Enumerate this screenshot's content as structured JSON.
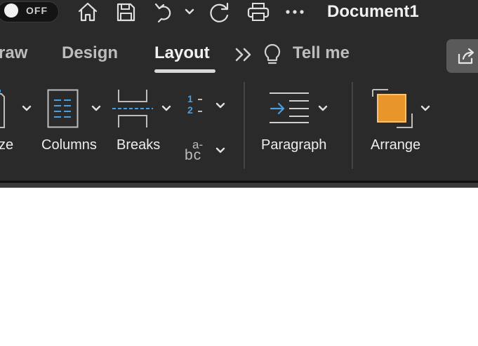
{
  "titlebar": {
    "autosave_label": "OFF",
    "document_title": "Document1",
    "icons": [
      "home-icon",
      "save-icon",
      "undo-icon",
      "chevron-down-icon",
      "redo-icon",
      "print-icon",
      "more-icon"
    ]
  },
  "tabs": [
    {
      "label": "raw",
      "active": false
    },
    {
      "label": "Design",
      "active": false
    },
    {
      "label": "Layout",
      "active": true
    },
    {
      "label": "Tell me",
      "active": false
    }
  ],
  "ribbon": {
    "size_label": "ze",
    "columns_label": "Columns",
    "breaks_label": "Breaks",
    "line_numbers_glyph_1": "1",
    "line_numbers_glyph_2": "2",
    "hyphenation_glyph_top": "a-",
    "hyphenation_glyph_bottom": "bc",
    "paragraph_label": "Paragraph",
    "arrange_label": "Arrange"
  },
  "colors": {
    "ribbon_bg": "#2a2a2a",
    "accent_blue": "#4a9fe0",
    "arrange_orange": "#e8962a"
  }
}
